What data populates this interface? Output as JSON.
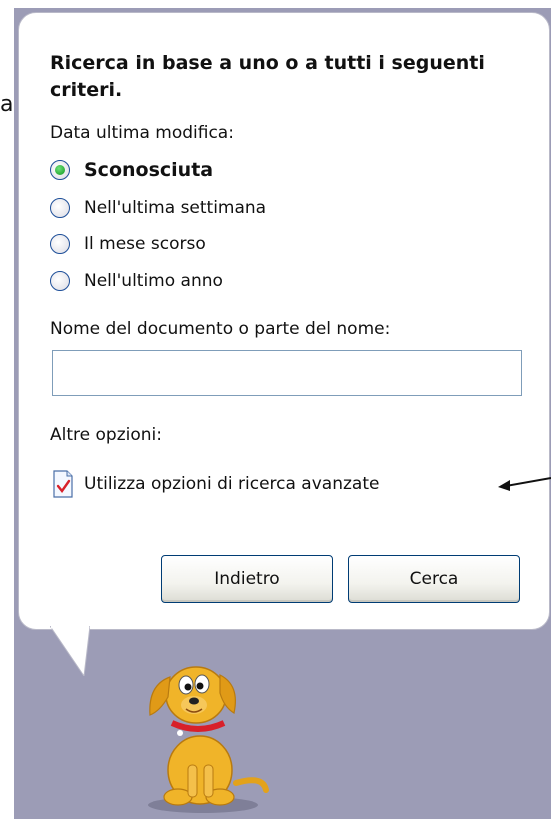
{
  "stray_text": "a",
  "search_panel": {
    "title": "Ricerca in base a uno o a tutti i seguenti criteri.",
    "date_label": "Data ultima modifica:",
    "date_options": [
      {
        "label": "Sconosciuta",
        "selected": true
      },
      {
        "label": "Nell'ultima settimana",
        "selected": false
      },
      {
        "label": "Il mese scorso",
        "selected": false
      },
      {
        "label": "Nell'ultimo anno",
        "selected": false
      }
    ],
    "name_label": "Nome del documento o parte del nome:",
    "name_value": "",
    "name_placeholder": "",
    "other_label": "Altre opzioni:",
    "advanced_link": "Utilizza opzioni di ricerca avanzate",
    "back_button": "Indietro",
    "search_button": "Cerca"
  },
  "icons": {
    "advanced": "document-check-icon",
    "assistant": "dog-assistant-icon"
  },
  "colors": {
    "panel_bg": "#9c9cb6",
    "radio_selected": "#21a531",
    "button_border": "#003c74"
  }
}
